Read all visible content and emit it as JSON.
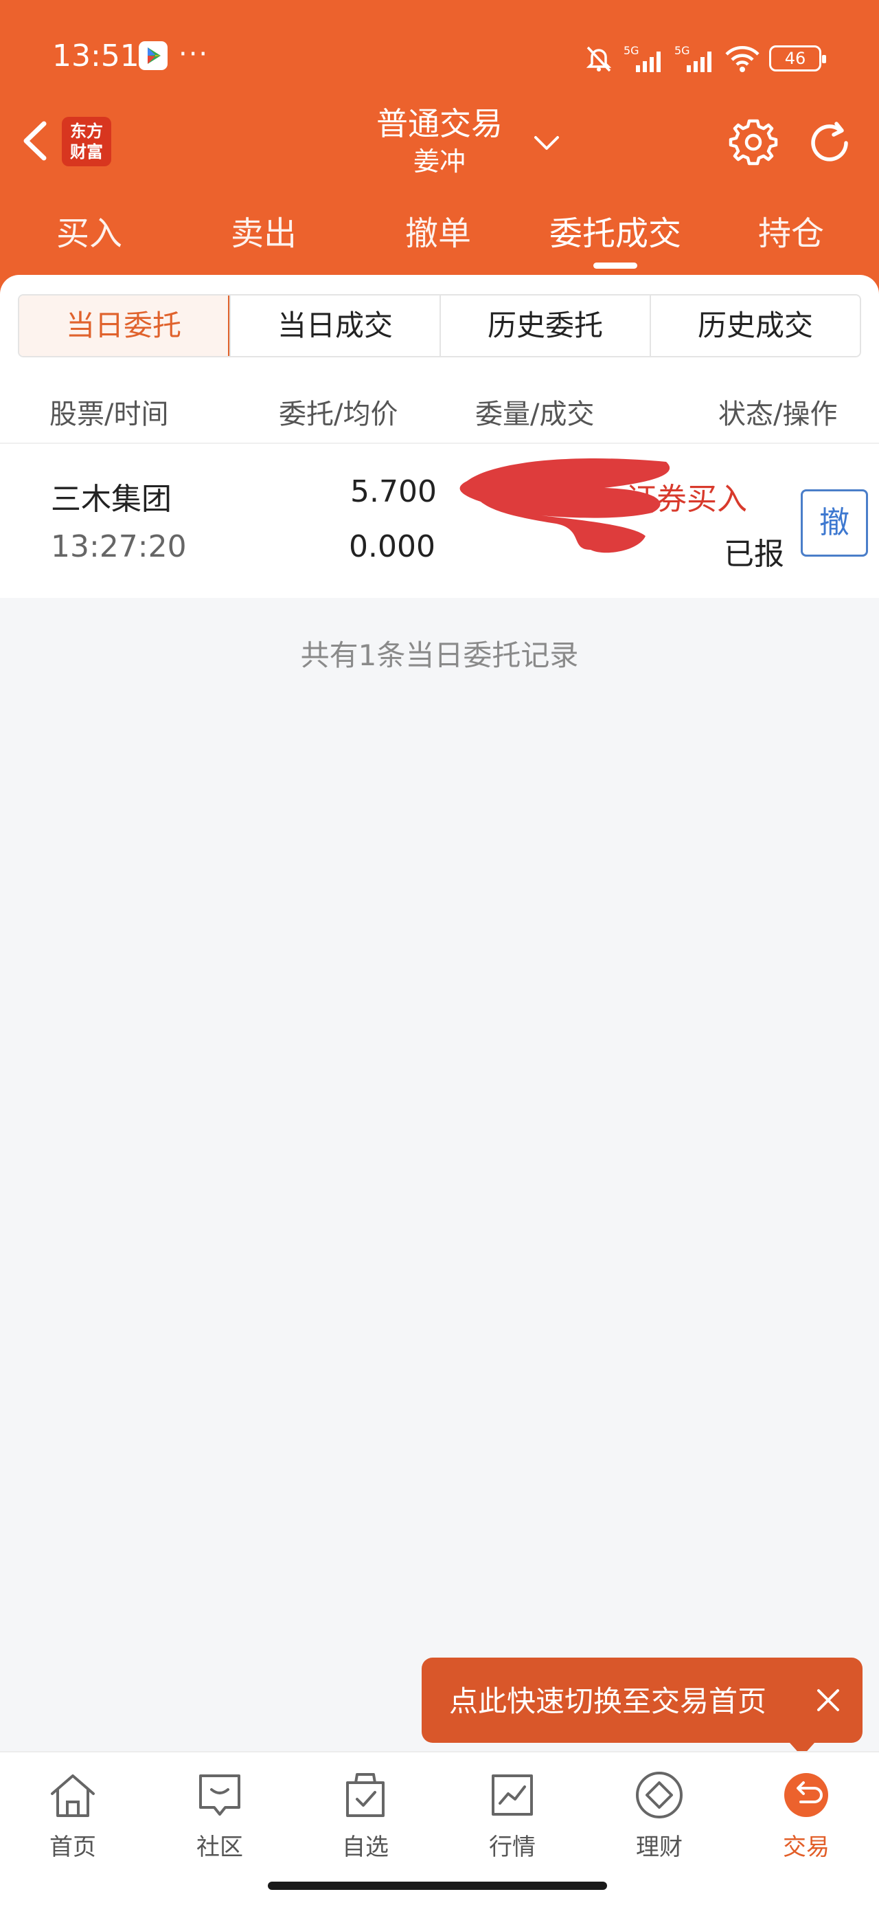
{
  "status_bar": {
    "time": "13:51",
    "dots": "···",
    "signal_1": "5G",
    "signal_2": "5G",
    "battery": "46"
  },
  "header": {
    "title": "普通交易",
    "subtitle": "姜冲",
    "logo_line1": "东方",
    "logo_line2": "财富"
  },
  "top_tabs": [
    {
      "label": "买入"
    },
    {
      "label": "卖出"
    },
    {
      "label": "撤单"
    },
    {
      "label": "委托成交"
    },
    {
      "label": "持仓"
    }
  ],
  "active_top_tab": "委托成交",
  "segments": [
    {
      "label": "当日委托"
    },
    {
      "label": "当日成交"
    },
    {
      "label": "历史委托"
    },
    {
      "label": "历史成交"
    }
  ],
  "active_segment": "当日委托",
  "columns": {
    "col1": "股票/时间",
    "col2": "委托/均价",
    "col3": "委量/成交",
    "col4": "状态/操作"
  },
  "orders": [
    {
      "stock": "三木集团",
      "time": "13:27:20",
      "order_price": "5.700",
      "avg_price": "0.000",
      "type": "证券买入",
      "status": "已报",
      "action": "撤"
    }
  ],
  "summary": "共有1条当日委托记录",
  "tooltip": {
    "text": "点此快速切换至交易首页"
  },
  "bottom_nav": [
    {
      "label": "首页",
      "icon": "home-icon"
    },
    {
      "label": "社区",
      "icon": "chat-icon"
    },
    {
      "label": "自选",
      "icon": "watchlist-icon"
    },
    {
      "label": "行情",
      "icon": "market-chart-icon"
    },
    {
      "label": "理财",
      "icon": "diamond-icon"
    },
    {
      "label": "交易",
      "icon": "trade-return-icon"
    }
  ],
  "active_nav": "交易",
  "colors": {
    "brand": "#ec622d",
    "accent_text": "#e0622c",
    "buy_red": "#d83a2c",
    "cancel_blue": "#3d78d0"
  }
}
